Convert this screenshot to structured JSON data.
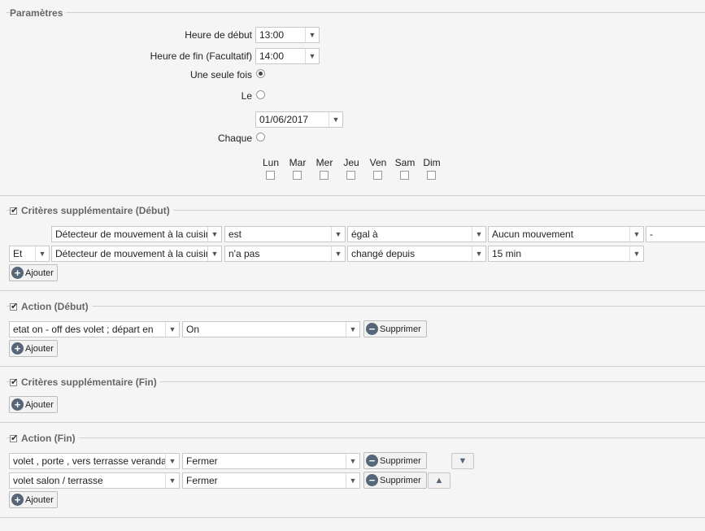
{
  "params": {
    "title": "Paramètres",
    "start_label": "Heure de début",
    "start_value": "13:00",
    "end_label": "Heure de fin (Facultatif)",
    "end_value": "14:00",
    "once_label": "Une seule fois",
    "on_label": "Le",
    "date_value": "01/06/2017",
    "each_label": "Chaque",
    "days": [
      "Lun",
      "Mar",
      "Mer",
      "Jeu",
      "Ven",
      "Sam",
      "Dim"
    ]
  },
  "criteria_start": {
    "title": "Critères supplémentaire (Début)",
    "rows": [
      {
        "op": "",
        "device": "Détecteur de mouvement à la cuisine",
        "verb": "est",
        "cmp": "égal à",
        "value": "Aucun mouvement",
        "extra": "-"
      },
      {
        "op": "Et",
        "device": "Détecteur de mouvement à la cuisine",
        "verb": "n'a pas",
        "cmp": "changé depuis",
        "value": "15 min",
        "extra": ""
      }
    ],
    "add_label": "Ajouter"
  },
  "action_start": {
    "title": "Action (Début)",
    "rows": [
      {
        "device": "etat on - off des volet ; départ en",
        "value": "On",
        "delete_label": "Supprimer"
      }
    ],
    "add_label": "Ajouter"
  },
  "criteria_end": {
    "title": "Critères supplémentaire (Fin)",
    "add_label": "Ajouter"
  },
  "action_end": {
    "title": "Action (Fin)",
    "rows": [
      {
        "device": "volet , porte , vers terrasse veranda",
        "value": "Fermer",
        "delete_label": "Supprimer",
        "move": "down-arrow-icon"
      },
      {
        "device": "volet salon / terrasse",
        "value": "Fermer",
        "delete_label": "Supprimer",
        "move": "up-arrow-icon"
      }
    ],
    "add_label": "Ajouter"
  },
  "colors": {
    "icon": "#556678",
    "background": "#f5f5f5"
  }
}
